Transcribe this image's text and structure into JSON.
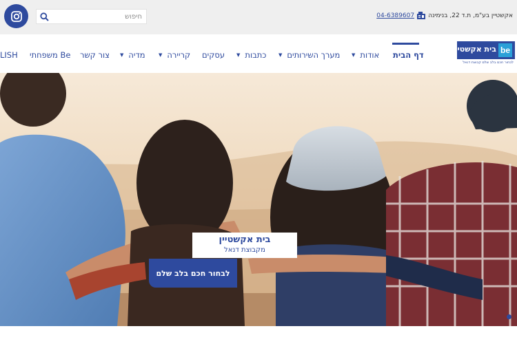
{
  "topbar": {
    "search_placeholder": "חיפוש",
    "address": "אקשטיין בע\"מ, ת.ד 22, בנימינה",
    "phone": "04-6389607",
    "icons": {
      "instagram": "instagram-icon",
      "search": "search-icon",
      "phone": "phone-fax-icon"
    }
  },
  "logo": {
    "name": "בית אקשטיין",
    "badge": "be",
    "tagline": "לבחור חכם בלב שלם קבוצת דנאל"
  },
  "nav": {
    "items": [
      {
        "label": "דף הבית",
        "active": true,
        "dropdown": false
      },
      {
        "label": "אודות",
        "active": false,
        "dropdown": true
      },
      {
        "label": "מערך השירותים",
        "active": false,
        "dropdown": true
      },
      {
        "label": "כתבות",
        "active": false,
        "dropdown": true
      },
      {
        "label": "עסקים",
        "active": false,
        "dropdown": false
      },
      {
        "label": "קריירה",
        "active": false,
        "dropdown": true
      },
      {
        "label": "מדיה",
        "active": false,
        "dropdown": true
      },
      {
        "label": "צור קשר",
        "active": false,
        "dropdown": false
      },
      {
        "label": "Be משפחתי",
        "active": false,
        "dropdown": false
      },
      {
        "label": "LISH",
        "active": false,
        "dropdown": false
      }
    ]
  },
  "hero": {
    "card_title": "בית אקשטיין",
    "card_subtitle": "מקבוצת דנאל",
    "cta_label": "לבחור חכם בלב שלם"
  },
  "colors": {
    "brand": "#2e4a9e",
    "accent": "#2aa0d8",
    "topbar": "#efefef"
  }
}
